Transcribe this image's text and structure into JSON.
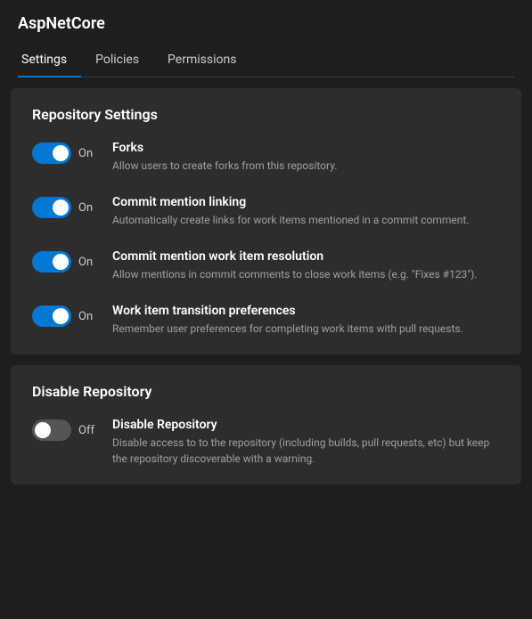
{
  "app": {
    "title": "AspNetCore"
  },
  "tabs": [
    {
      "id": "settings",
      "label": "Settings",
      "active": true
    },
    {
      "id": "policies",
      "label": "Policies",
      "active": false
    },
    {
      "id": "permissions",
      "label": "Permissions",
      "active": false
    }
  ],
  "sections": [
    {
      "id": "repository-settings",
      "title": "Repository Settings",
      "settings": [
        {
          "id": "forks",
          "state": "on",
          "name": "Forks",
          "description": "Allow users to create forks from this repository."
        },
        {
          "id": "commit-mention-linking",
          "state": "on",
          "name": "Commit mention linking",
          "description": "Automatically create links for work items mentioned in a commit comment."
        },
        {
          "id": "commit-mention-work-item",
          "state": "on",
          "name": "Commit mention work item resolution",
          "description": "Allow mentions in commit comments to close work items (e.g. \"Fixes #123\")."
        },
        {
          "id": "work-item-transition",
          "state": "on",
          "name": "Work item transition preferences",
          "description": "Remember user preferences for completing work items with pull requests."
        }
      ]
    },
    {
      "id": "disable-repository",
      "title": "Disable Repository",
      "settings": [
        {
          "id": "disable-repo",
          "state": "off",
          "name": "Disable Repository",
          "description": "Disable access to to the repository (including builds, pull requests, etc) but keep the repository discoverable with a warning."
        }
      ]
    }
  ],
  "labels": {
    "on": "On",
    "off": "Off"
  }
}
